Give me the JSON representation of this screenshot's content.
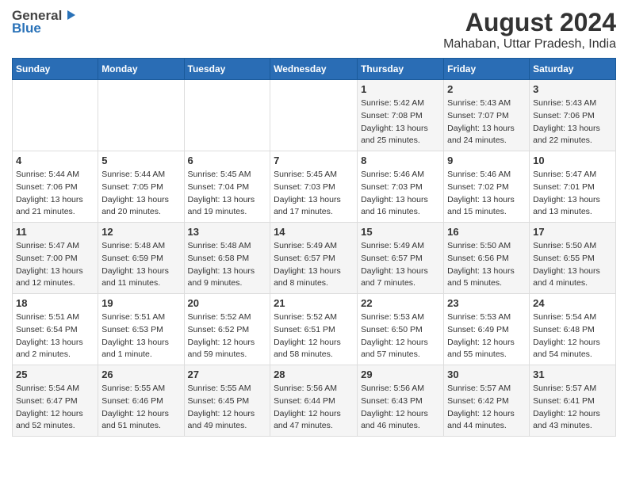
{
  "header": {
    "logo_general": "General",
    "logo_blue": "Blue",
    "title": "August 2024",
    "subtitle": "Mahaban, Uttar Pradesh, India"
  },
  "calendar": {
    "days_of_week": [
      "Sunday",
      "Monday",
      "Tuesday",
      "Wednesday",
      "Thursday",
      "Friday",
      "Saturday"
    ],
    "weeks": [
      [
        {
          "day": "",
          "info": ""
        },
        {
          "day": "",
          "info": ""
        },
        {
          "day": "",
          "info": ""
        },
        {
          "day": "",
          "info": ""
        },
        {
          "day": "1",
          "info": "Sunrise: 5:42 AM\nSunset: 7:08 PM\nDaylight: 13 hours\nand 25 minutes."
        },
        {
          "day": "2",
          "info": "Sunrise: 5:43 AM\nSunset: 7:07 PM\nDaylight: 13 hours\nand 24 minutes."
        },
        {
          "day": "3",
          "info": "Sunrise: 5:43 AM\nSunset: 7:06 PM\nDaylight: 13 hours\nand 22 minutes."
        }
      ],
      [
        {
          "day": "4",
          "info": "Sunrise: 5:44 AM\nSunset: 7:06 PM\nDaylight: 13 hours\nand 21 minutes."
        },
        {
          "day": "5",
          "info": "Sunrise: 5:44 AM\nSunset: 7:05 PM\nDaylight: 13 hours\nand 20 minutes."
        },
        {
          "day": "6",
          "info": "Sunrise: 5:45 AM\nSunset: 7:04 PM\nDaylight: 13 hours\nand 19 minutes."
        },
        {
          "day": "7",
          "info": "Sunrise: 5:45 AM\nSunset: 7:03 PM\nDaylight: 13 hours\nand 17 minutes."
        },
        {
          "day": "8",
          "info": "Sunrise: 5:46 AM\nSunset: 7:03 PM\nDaylight: 13 hours\nand 16 minutes."
        },
        {
          "day": "9",
          "info": "Sunrise: 5:46 AM\nSunset: 7:02 PM\nDaylight: 13 hours\nand 15 minutes."
        },
        {
          "day": "10",
          "info": "Sunrise: 5:47 AM\nSunset: 7:01 PM\nDaylight: 13 hours\nand 13 minutes."
        }
      ],
      [
        {
          "day": "11",
          "info": "Sunrise: 5:47 AM\nSunset: 7:00 PM\nDaylight: 13 hours\nand 12 minutes."
        },
        {
          "day": "12",
          "info": "Sunrise: 5:48 AM\nSunset: 6:59 PM\nDaylight: 13 hours\nand 11 minutes."
        },
        {
          "day": "13",
          "info": "Sunrise: 5:48 AM\nSunset: 6:58 PM\nDaylight: 13 hours\nand 9 minutes."
        },
        {
          "day": "14",
          "info": "Sunrise: 5:49 AM\nSunset: 6:57 PM\nDaylight: 13 hours\nand 8 minutes."
        },
        {
          "day": "15",
          "info": "Sunrise: 5:49 AM\nSunset: 6:57 PM\nDaylight: 13 hours\nand 7 minutes."
        },
        {
          "day": "16",
          "info": "Sunrise: 5:50 AM\nSunset: 6:56 PM\nDaylight: 13 hours\nand 5 minutes."
        },
        {
          "day": "17",
          "info": "Sunrise: 5:50 AM\nSunset: 6:55 PM\nDaylight: 13 hours\nand 4 minutes."
        }
      ],
      [
        {
          "day": "18",
          "info": "Sunrise: 5:51 AM\nSunset: 6:54 PM\nDaylight: 13 hours\nand 2 minutes."
        },
        {
          "day": "19",
          "info": "Sunrise: 5:51 AM\nSunset: 6:53 PM\nDaylight: 13 hours\nand 1 minute."
        },
        {
          "day": "20",
          "info": "Sunrise: 5:52 AM\nSunset: 6:52 PM\nDaylight: 12 hours\nand 59 minutes."
        },
        {
          "day": "21",
          "info": "Sunrise: 5:52 AM\nSunset: 6:51 PM\nDaylight: 12 hours\nand 58 minutes."
        },
        {
          "day": "22",
          "info": "Sunrise: 5:53 AM\nSunset: 6:50 PM\nDaylight: 12 hours\nand 57 minutes."
        },
        {
          "day": "23",
          "info": "Sunrise: 5:53 AM\nSunset: 6:49 PM\nDaylight: 12 hours\nand 55 minutes."
        },
        {
          "day": "24",
          "info": "Sunrise: 5:54 AM\nSunset: 6:48 PM\nDaylight: 12 hours\nand 54 minutes."
        }
      ],
      [
        {
          "day": "25",
          "info": "Sunrise: 5:54 AM\nSunset: 6:47 PM\nDaylight: 12 hours\nand 52 minutes."
        },
        {
          "day": "26",
          "info": "Sunrise: 5:55 AM\nSunset: 6:46 PM\nDaylight: 12 hours\nand 51 minutes."
        },
        {
          "day": "27",
          "info": "Sunrise: 5:55 AM\nSunset: 6:45 PM\nDaylight: 12 hours\nand 49 minutes."
        },
        {
          "day": "28",
          "info": "Sunrise: 5:56 AM\nSunset: 6:44 PM\nDaylight: 12 hours\nand 47 minutes."
        },
        {
          "day": "29",
          "info": "Sunrise: 5:56 AM\nSunset: 6:43 PM\nDaylight: 12 hours\nand 46 minutes."
        },
        {
          "day": "30",
          "info": "Sunrise: 5:57 AM\nSunset: 6:42 PM\nDaylight: 12 hours\nand 44 minutes."
        },
        {
          "day": "31",
          "info": "Sunrise: 5:57 AM\nSunset: 6:41 PM\nDaylight: 12 hours\nand 43 minutes."
        }
      ]
    ]
  }
}
